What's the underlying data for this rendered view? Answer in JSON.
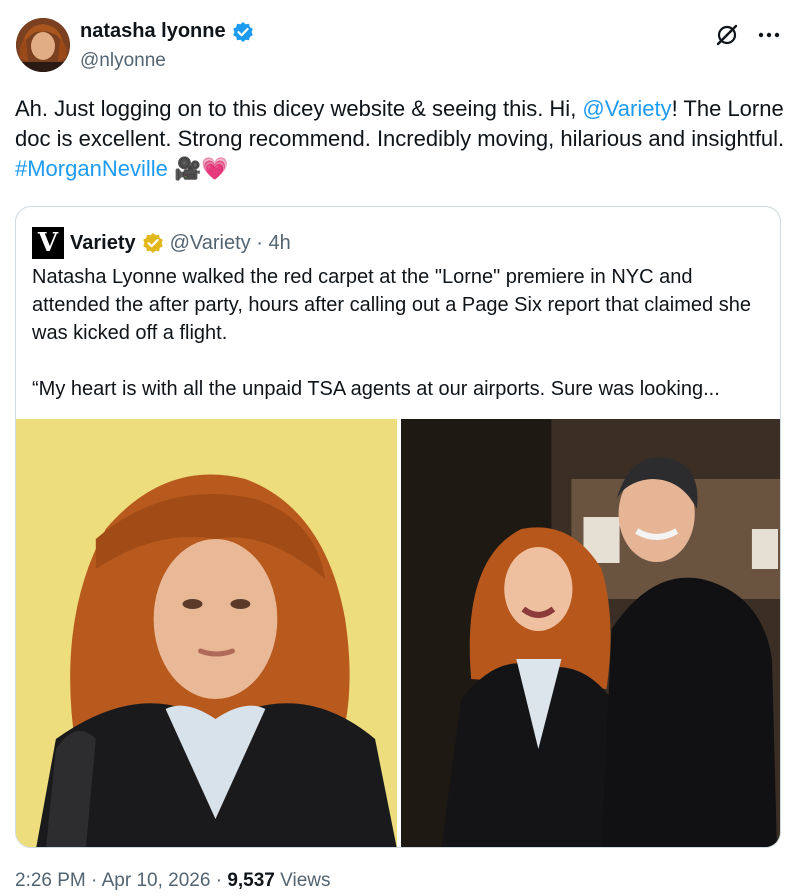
{
  "author": {
    "name": "natasha lyonne",
    "handle": "@nlyonne"
  },
  "tweet": {
    "text_before": "Ah. Just logging on to this dicey website & seeing this. Hi, ",
    "mention": "@Variety",
    "text_middle": "! The Lorne doc is excellent. Strong recommend. Incredibly moving, hilarious and insightful. ",
    "hashtag": "#MorganNeville",
    "emoji": " 🎥💗"
  },
  "quote": {
    "logo_letter": "V",
    "name": "Variety",
    "handle_time": "@Variety · 4h",
    "paragraph1": "Natasha Lyonne walked the red carpet at the \"Lorne\" premiere in NYC and attended the after party, hours after calling out a Page Six report that claimed she was kicked off a flight.",
    "paragraph2": "“My  heart is with all the unpaid TSA agents at our airports. Sure was  looking..."
  },
  "footer": {
    "time": "2:26 PM",
    "separator": " · ",
    "date": "Apr 10, 2026",
    "views_count": "9,537",
    "views_label": "Views"
  },
  "icons": {
    "verified_blue": "#1d9bf0",
    "verified_gold": "#e2b719"
  }
}
